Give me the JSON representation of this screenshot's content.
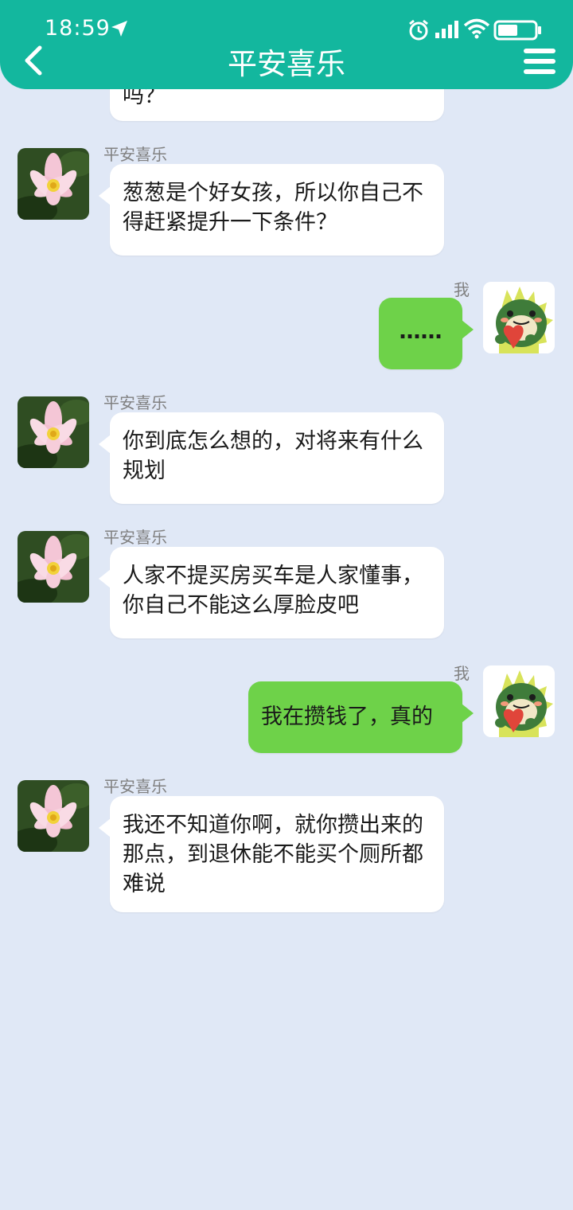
{
  "status_bar": {
    "time": "18:59"
  },
  "header": {
    "title": "平安喜乐"
  },
  "messages": [
    {
      "sender": "",
      "side": "left",
      "text": "吗？"
    },
    {
      "sender": "平安喜乐",
      "side": "left",
      "text": "葱葱是个好女孩，所以你自己不得赶紧提升一下条件？"
    },
    {
      "sender": "我",
      "side": "right",
      "text": "……"
    },
    {
      "sender": "平安喜乐",
      "side": "left",
      "text": "你到底怎么想的，对将来有什么规划"
    },
    {
      "sender": "平安喜乐",
      "side": "left",
      "text": "人家不提买房买车是人家懂事，你自己不能这么厚脸皮吧"
    },
    {
      "sender": "我",
      "side": "right",
      "text": "我在攒钱了，真的"
    },
    {
      "sender": "平安喜乐",
      "side": "left",
      "text": "我还不知道你啊，就你攒出来的那点，到退休能不能买个厕所都难说"
    }
  ],
  "colors": {
    "header": "#13b79e",
    "background": "#e0e8f6",
    "bubble_left": "#ffffff",
    "bubble_right": "#6ed249"
  },
  "icons": [
    "location-arrow-icon",
    "alarm-icon",
    "signal-icon",
    "wifi-icon",
    "battery-icon",
    "back-arrow-icon",
    "menu-icon",
    "lotus-avatar",
    "dinosaur-avatar"
  ]
}
